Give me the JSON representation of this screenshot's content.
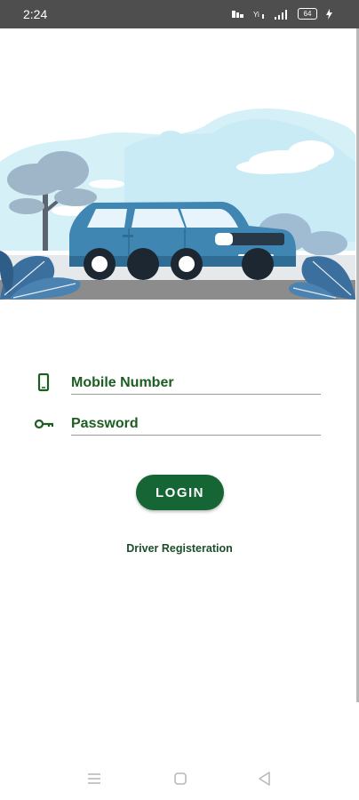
{
  "status_bar": {
    "time": "2:24",
    "battery": "64"
  },
  "hero": {
    "icon": "car-illustration",
    "colors": {
      "sky": "#d6f0f7",
      "cloud": "#ffffff",
      "car_body": "#3f86b3",
      "car_window": "#e8f4fb",
      "tree": "#9fb6c8",
      "leaf": "#3a6f9e",
      "road": "#8c8c8c",
      "sidewalk": "#e5e9ec"
    }
  },
  "form": {
    "mobile": {
      "placeholder": "Mobile Number",
      "icon": "phone-icon"
    },
    "password": {
      "placeholder": "Password",
      "icon": "key-icon"
    }
  },
  "login_button": {
    "label": "LOGIN"
  },
  "register_link": {
    "label": "Driver Registeration"
  },
  "nav_bar": {
    "icons": [
      "menu-icon",
      "home-square-icon",
      "back-triangle-icon"
    ]
  },
  "colors": {
    "primary": "#166534",
    "primary_text": "#1b5e20",
    "status_bar": "#4e4e4e"
  }
}
